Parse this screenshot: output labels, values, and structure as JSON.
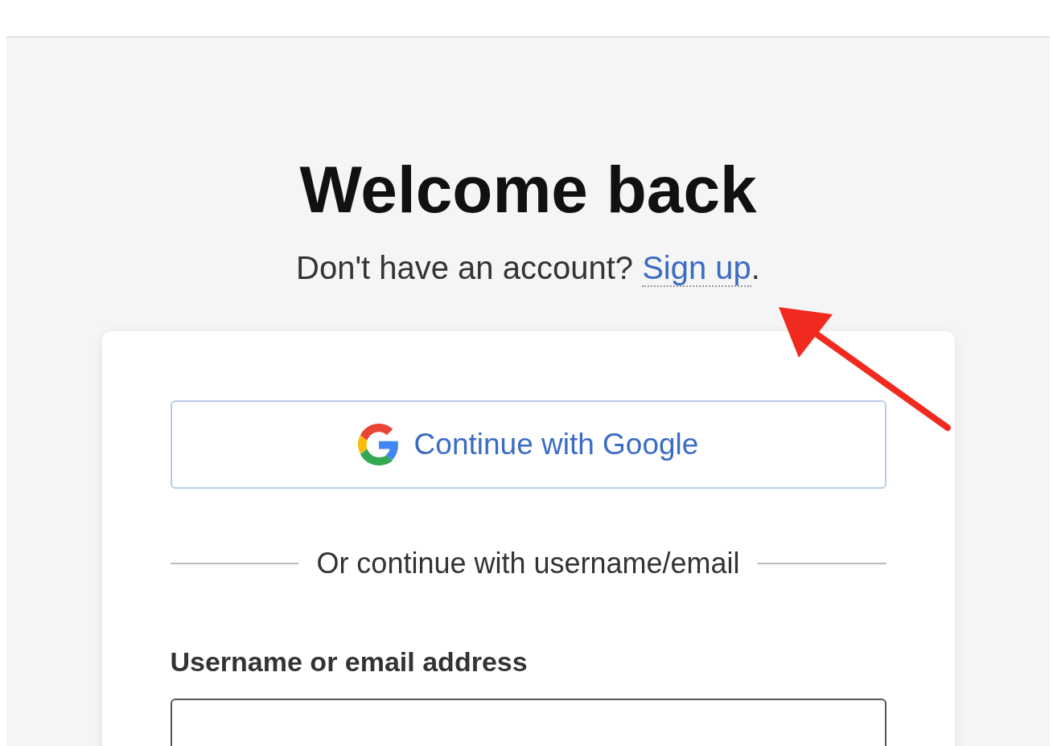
{
  "heading": "Welcome back",
  "subtitle": {
    "text": "Don't have an account?",
    "link": "Sign up",
    "end": "."
  },
  "google_button": {
    "label": "Continue with Google"
  },
  "divider": "Or continue with username/email",
  "username_field": {
    "label": "Username or email address"
  }
}
